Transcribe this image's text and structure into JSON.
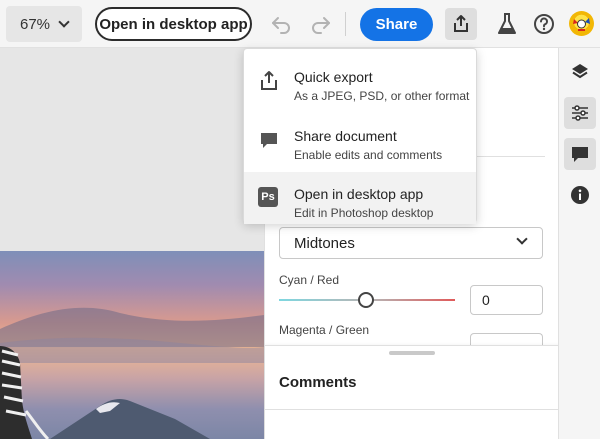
{
  "toolbar": {
    "zoom": "67%",
    "open_desktop_label": "Open in desktop app",
    "share_label": "Share"
  },
  "menu": {
    "items": [
      {
        "title": "Quick export",
        "subtitle": "As a JPEG, PSD, or other format",
        "icon": "export-icon"
      },
      {
        "title": "Share document",
        "subtitle": "Enable edits and comments",
        "icon": "comment-icon"
      },
      {
        "title": "Open in desktop app",
        "subtitle": "Edit in Photoshop desktop",
        "icon": "photoshop-icon",
        "icon_text": "Ps"
      }
    ]
  },
  "panel": {
    "tone_select": "Midtones",
    "cyan_red_label": "Cyan / Red",
    "cyan_red_value": "0",
    "magenta_green_label": "Magenta / Green",
    "comments_title": "Comments"
  },
  "colors": {
    "accent": "#1473e6",
    "panel_bg": "#ffffff",
    "toolbar_bg": "#f5f5f5"
  }
}
